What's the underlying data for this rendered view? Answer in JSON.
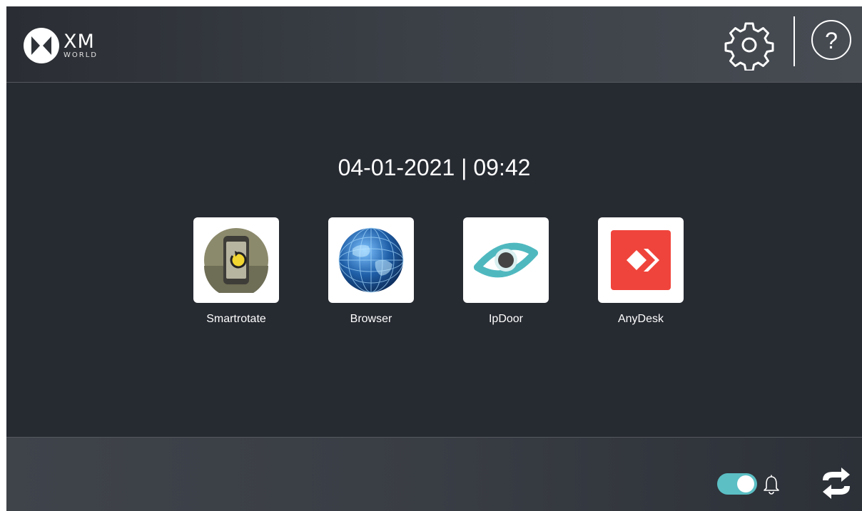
{
  "header": {
    "logo": {
      "main": "XM",
      "sub": "WORLD"
    },
    "settings_icon": "gear-icon",
    "help_icon": "help-icon",
    "help_glyph": "?"
  },
  "datetime": "04-01-2021 | 09:42",
  "apps": [
    {
      "label": "Smartrotate",
      "icon": "smartrotate-icon"
    },
    {
      "label": "Browser",
      "icon": "browser-globe-icon"
    },
    {
      "label": "IpDoor",
      "icon": "ipdoor-eye-icon"
    },
    {
      "label": "AnyDesk",
      "icon": "anydesk-icon"
    }
  ],
  "footer": {
    "notification_toggle": {
      "state": "on",
      "color": "#5bbfc4"
    },
    "bell_icon": "bell-icon",
    "sync_icon": "sync-icon"
  },
  "colors": {
    "background": "#262a31",
    "accent": "#5bbfc4",
    "anydesk_red": "#ef443b"
  }
}
